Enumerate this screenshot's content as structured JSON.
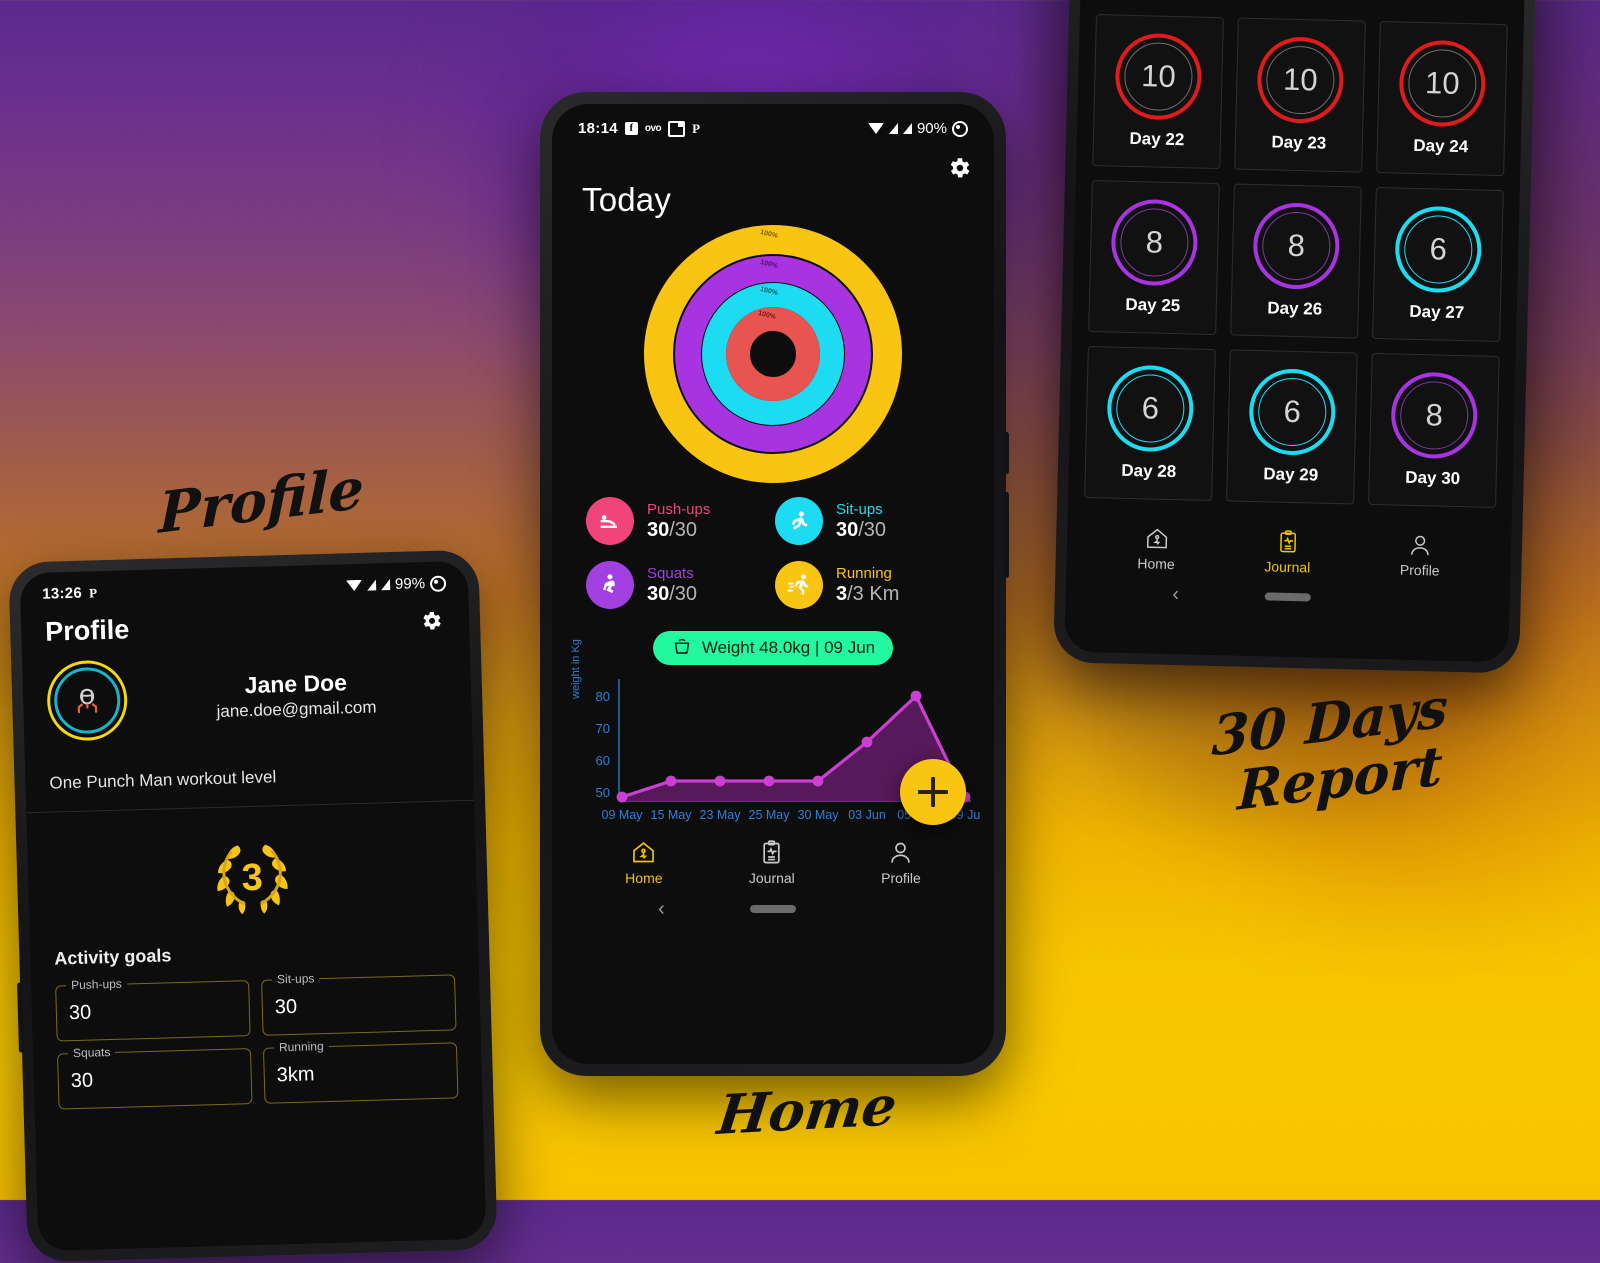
{
  "background": {
    "gradient_top": "#5b2a8c",
    "gradient_mid": "#bd7323",
    "gradient_bottom": "#f8c200"
  },
  "annotations": {
    "profile": "Profile",
    "home": "Home",
    "report_line1": "30 Days",
    "report_line2": "Report"
  },
  "home_phone": {
    "status_bar": {
      "time": "18:14",
      "icons": [
        "facebook-icon",
        "ovo-icon",
        "screenshot-icon",
        "pinterest-icon"
      ],
      "wifi": "wifi-icon",
      "signal1": "signal-icon",
      "signal2": "signal-icon",
      "battery": "90%",
      "recording": "record-icon"
    },
    "title": "Today",
    "settings_icon": "gear-icon",
    "rings": [
      {
        "name": "Running",
        "label": "100%",
        "color": "#f9c412",
        "percent": 100
      },
      {
        "name": "Squats",
        "label": "100%",
        "color": "#a734e0",
        "percent": 100
      },
      {
        "name": "Sit-ups",
        "label": "100%",
        "color": "#1ddcf2",
        "percent": 100
      },
      {
        "name": "Push-ups",
        "label": "100%",
        "color": "#e8544f",
        "percent": 100
      }
    ],
    "stats": [
      {
        "name": "Push-ups",
        "value": "30",
        "goal": "/30",
        "color": "#f0447a",
        "icon": "pushup-icon"
      },
      {
        "name": "Sit-ups",
        "value": "30",
        "goal": "/30",
        "color": "#1ddcf2",
        "icon": "situp-icon"
      },
      {
        "name": "Squats",
        "value": "30",
        "goal": "/30",
        "color": "#a13fe0",
        "icon": "squat-icon"
      },
      {
        "name": "Running",
        "value": "3",
        "goal": "/3 Km",
        "color": "#f9c412",
        "icon": "running-icon"
      }
    ],
    "weight_pill": {
      "icon": "scale-icon",
      "text": "Weight 48.0kg | 09 Jun",
      "color": "#23f7a0"
    },
    "fab": {
      "icon": "plus-icon",
      "color": "#f9c412"
    },
    "nav": [
      {
        "label": "Home",
        "icon": "home-icon",
        "active": true
      },
      {
        "label": "Journal",
        "icon": "clipboard-icon",
        "active": false
      },
      {
        "label": "Profile",
        "icon": "person-icon",
        "active": false
      }
    ]
  },
  "chart_data": {
    "type": "line",
    "title": "",
    "xlabel": "",
    "ylabel": "weight in Kg",
    "categories": [
      "09 May",
      "15 May",
      "23 May",
      "25 May",
      "30 May",
      "03 Jun",
      "05 Jun",
      "09 Ju"
    ],
    "values": [
      49,
      54,
      54,
      54,
      54,
      66,
      84,
      49
    ],
    "ylim": [
      45,
      88
    ],
    "yticks": [
      "50",
      "60",
      "70",
      "80"
    ],
    "series": [
      {
        "name": "weight in Kg",
        "values": [
          49,
          54,
          54,
          54,
          54,
          66,
          84,
          49
        ],
        "color": "#cc3fd4"
      }
    ],
    "grid": false,
    "legend": "none",
    "axis_color": "#2f7fd6",
    "fill_color": "#5b1a5e"
  },
  "profile_phone": {
    "status_bar": {
      "time": "13:26",
      "icons": [
        "pinterest-icon"
      ],
      "battery": "99%"
    },
    "title": "Profile",
    "settings_icon": "gear-icon",
    "avatar_icon": "woman-avatar-icon",
    "name": "Jane Doe",
    "email": "jane.doe@gmail.com",
    "workout_level_label": "One Punch Man workout level",
    "level_badge": "3",
    "goals_heading": "Activity goals",
    "goals": [
      {
        "label": "Push-ups",
        "value": "30"
      },
      {
        "label": "Sit-ups",
        "value": "30"
      },
      {
        "label": "Squats",
        "value": "30"
      },
      {
        "label": "Running",
        "value": "3km"
      }
    ]
  },
  "report_phone": {
    "days": [
      {
        "label": "Day 22",
        "value": "10",
        "color": "#e01b1b"
      },
      {
        "label": "Day 23",
        "value": "10",
        "color": "#e01b1b"
      },
      {
        "label": "Day 24",
        "value": "10",
        "color": "#e01b1b"
      },
      {
        "label": "Day 25",
        "value": "8",
        "color": "#a734e0"
      },
      {
        "label": "Day 26",
        "value": "8",
        "color": "#a734e0"
      },
      {
        "label": "Day 27",
        "value": "6",
        "color": "#1ddcf2"
      },
      {
        "label": "Day 28",
        "value": "6",
        "color": "#1ddcf2"
      },
      {
        "label": "Day 29",
        "value": "6",
        "color": "#1ddcf2"
      },
      {
        "label": "Day 30",
        "value": "8",
        "color": "#a734e0"
      }
    ],
    "nav": [
      {
        "label": "Home",
        "icon": "home-icon",
        "active": false
      },
      {
        "label": "Journal",
        "icon": "clipboard-icon",
        "active": true
      },
      {
        "label": "Profile",
        "icon": "person-icon",
        "active": false
      }
    ]
  }
}
